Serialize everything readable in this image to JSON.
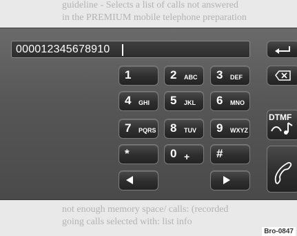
{
  "background_text": {
    "top_line_1": "guideline - Selects a list of calls not answered",
    "top_line_2": "in the PREMIUM mobile telephone preparation",
    "bottom_line_1": "not enough memory space/ calls: (recorded",
    "bottom_line_2": "going calls selected with: list info"
  },
  "display": {
    "number": "000012345678910"
  },
  "keypad": [
    {
      "digit": "1",
      "letters": ""
    },
    {
      "digit": "2",
      "letters": "ABC"
    },
    {
      "digit": "3",
      "letters": "DEF"
    },
    {
      "digit": "4",
      "letters": "GHI"
    },
    {
      "digit": "5",
      "letters": "JKL"
    },
    {
      "digit": "6",
      "letters": "MNO"
    },
    {
      "digit": "7",
      "letters": "PQRS"
    },
    {
      "digit": "8",
      "letters": "TUV"
    },
    {
      "digit": "9",
      "letters": "WXYZ"
    },
    {
      "digit": "*",
      "letters": ""
    },
    {
      "digit": "0",
      "letters": "+"
    },
    {
      "digit": "#",
      "letters": ""
    }
  ],
  "side_buttons": {
    "dtmf_label": "DTMF"
  },
  "figure_tag": "Bro-0847"
}
